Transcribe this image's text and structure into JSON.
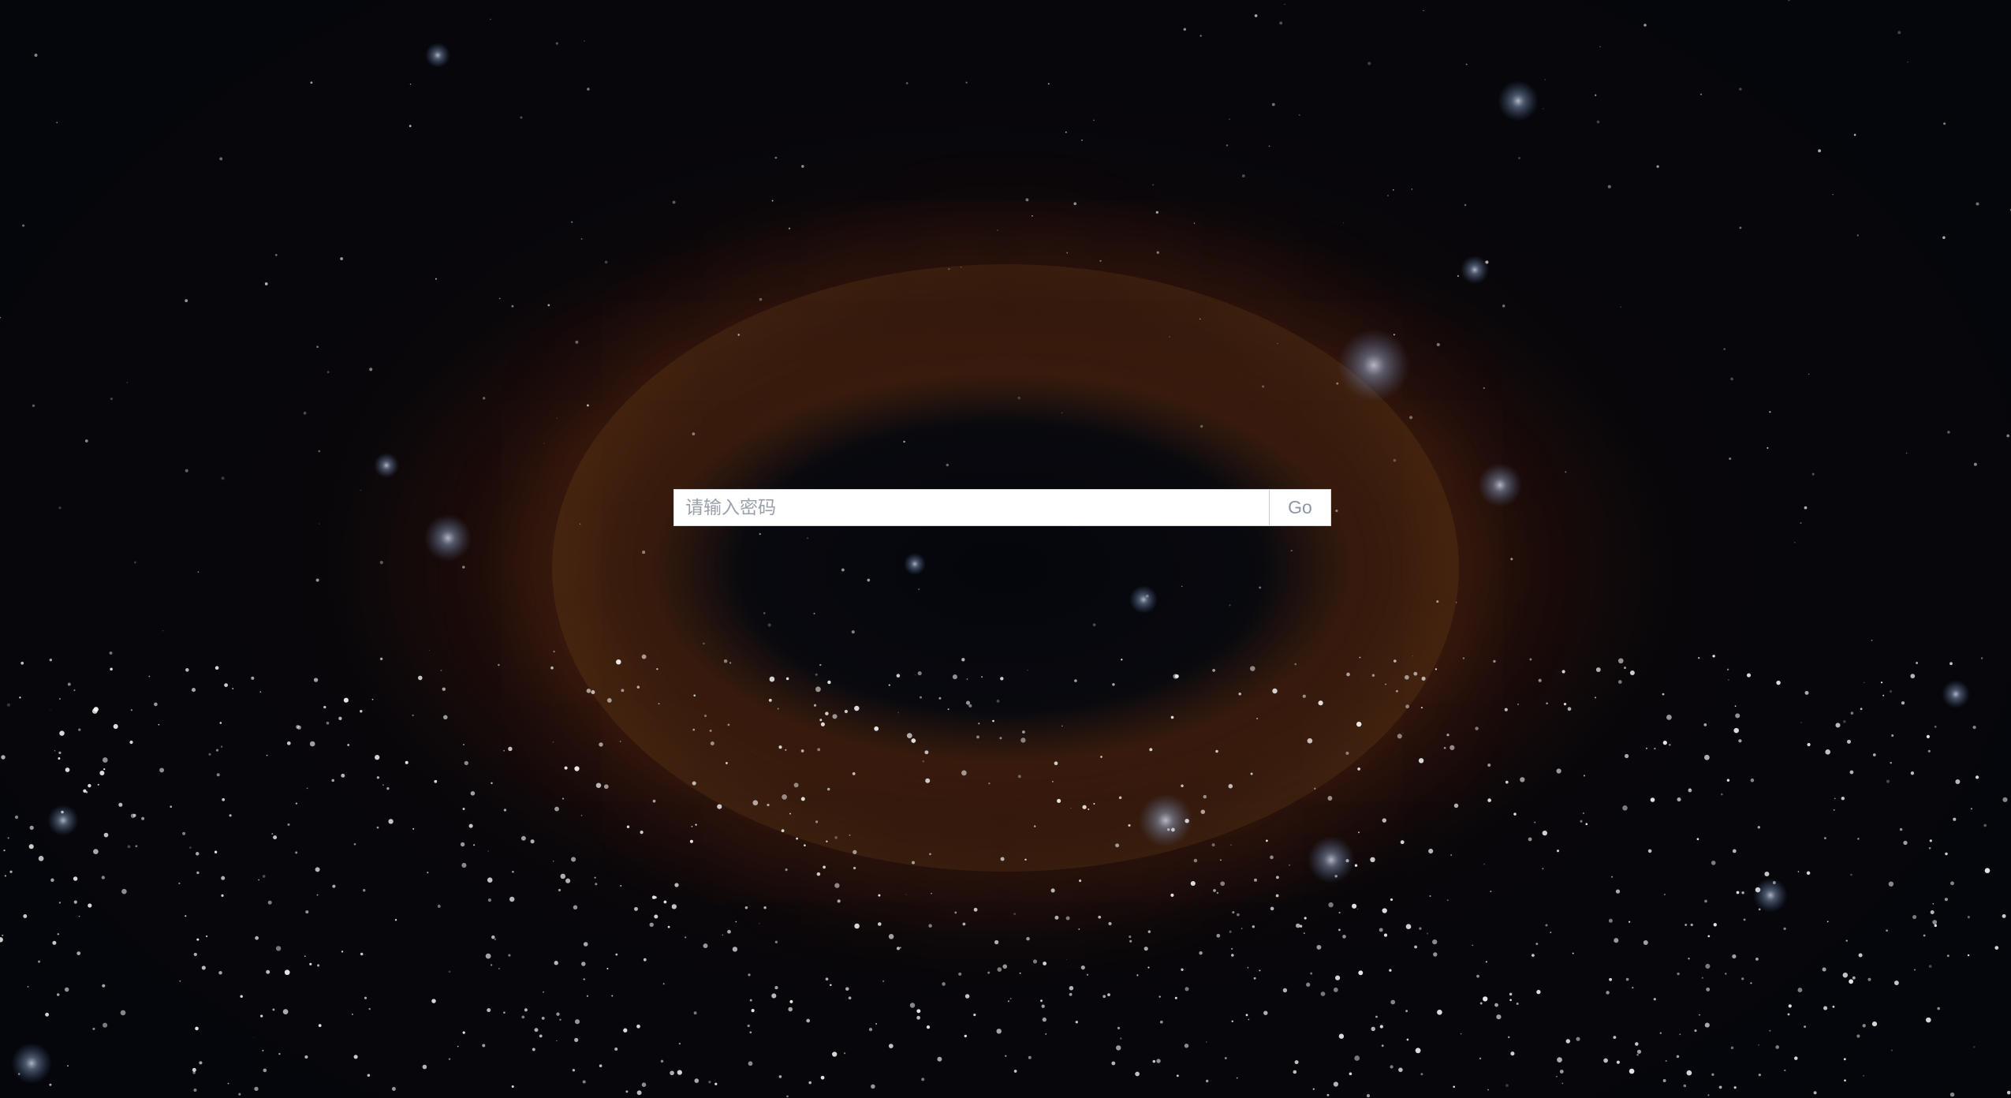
{
  "login": {
    "password_placeholder": "请输入密码",
    "password_value": "",
    "submit_label": "Go"
  },
  "theme": {
    "background": "#05060b",
    "nebula_color": "#8a4a1c",
    "star_color": "#ffffff",
    "input_background": "#ffffff",
    "placeholder_color": "#9aa1ab",
    "button_text_color": "#8d96a3"
  }
}
